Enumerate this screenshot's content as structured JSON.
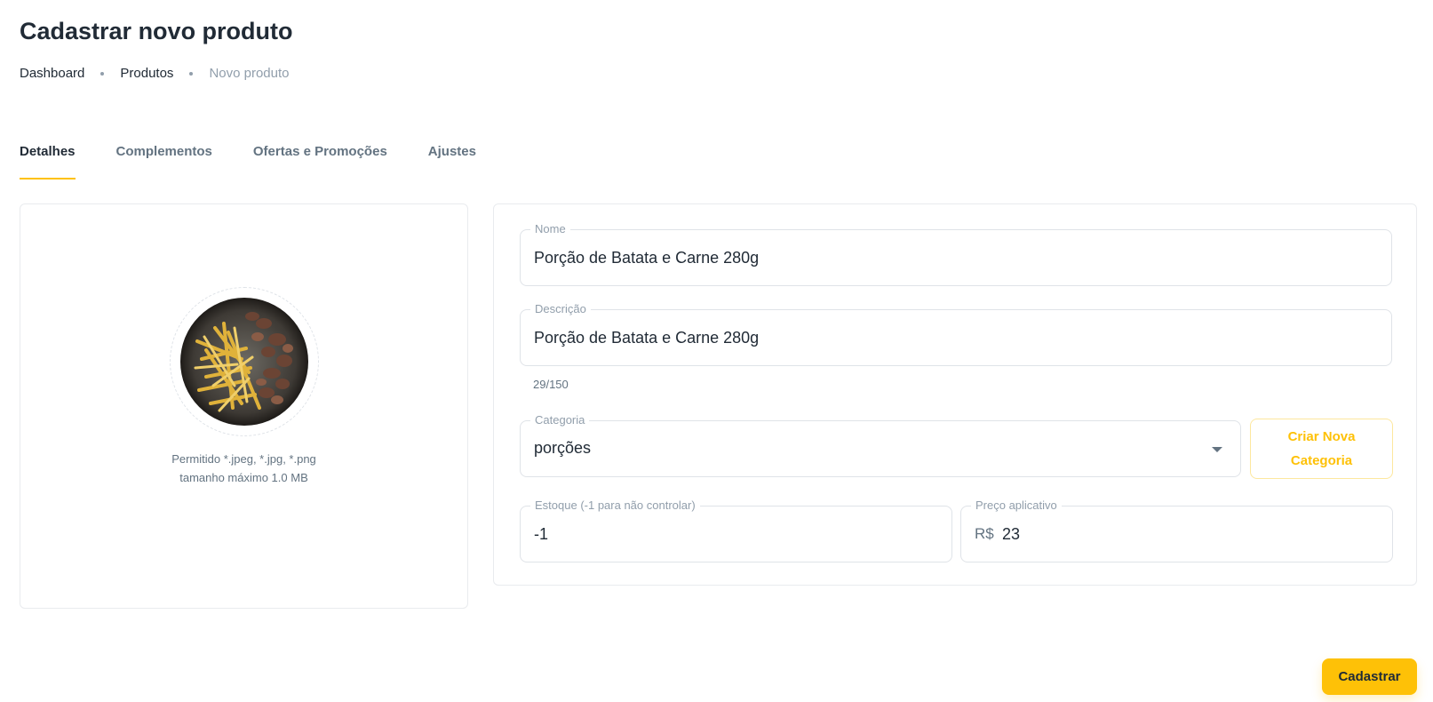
{
  "page": {
    "title": "Cadastrar novo produto"
  },
  "breadcrumb": [
    "Dashboard",
    "Produtos",
    "Novo produto"
  ],
  "tabs": [
    {
      "label": "Detalhes",
      "active": true
    },
    {
      "label": "Complementos",
      "active": false
    },
    {
      "label": "Ofertas e Promoções",
      "active": false
    },
    {
      "label": "Ajustes",
      "active": false
    }
  ],
  "upload": {
    "hint_line1": "Permitido *.jpeg, *.jpg, *.png",
    "hint_line2": "tamanho máximo 1.0 MB",
    "image_desc": "fries-and-meat-photo"
  },
  "form": {
    "nome": {
      "label": "Nome",
      "value": "Porção de Batata e Carne 280g"
    },
    "descricao": {
      "label": "Descrição",
      "value": "Porção de Batata e Carne 280g",
      "counter": "29/150"
    },
    "categoria": {
      "label": "Categoria",
      "value": "porções"
    },
    "create_category_label": "Criar Nova Categoria",
    "estoque": {
      "label": "Estoque (-1 para não controlar)",
      "value": "-1"
    },
    "preco": {
      "label": "Preço aplicativo",
      "prefix": "R$",
      "value": "23"
    }
  },
  "actions": {
    "submit_label": "Cadastrar"
  },
  "colors": {
    "accent": "#fec107",
    "text": "#212b36",
    "muted": "#637381",
    "border": "#dfe3e8"
  }
}
